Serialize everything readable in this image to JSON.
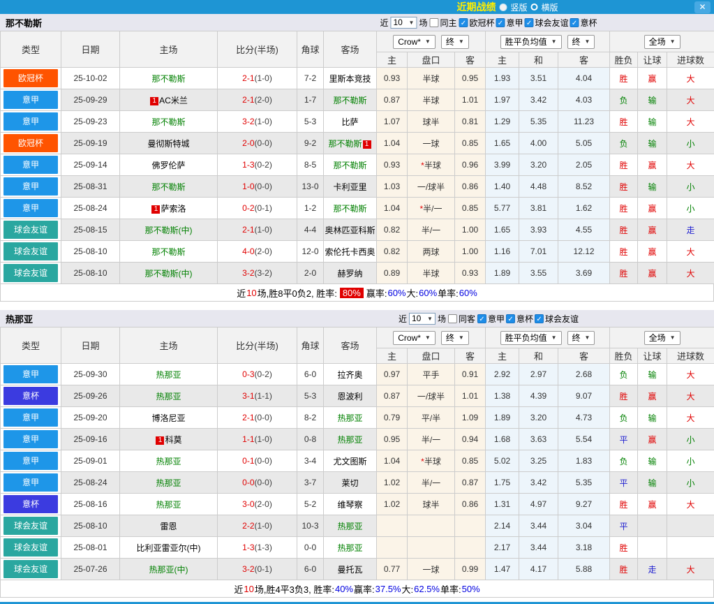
{
  "topbar": {
    "title": "近期战绩",
    "radio_vertical": "竖版",
    "radio_horizontal": "横版",
    "close": "✕"
  },
  "table_header": {
    "main_cols": [
      "类型",
      "日期",
      "主场",
      "比分(半场)",
      "角球",
      "客场"
    ],
    "sub_cols": [
      "主",
      "盘口",
      "客",
      "主",
      "和",
      "客",
      "胜负",
      "让球",
      "进球数"
    ],
    "odds_select": "Crow*",
    "odds_final_select": "终",
    "mean_select": "胜平负均值",
    "mean_final_select": "终",
    "scope_select": "全场",
    "caret": "▼"
  },
  "type_colors": {
    "欧冠杯": "#ff5400",
    "意甲": "#1e96e8",
    "意杯": "#3b3be0",
    "球会友谊": "#2aa7a0"
  },
  "sections": [
    {
      "team": "那不勒斯",
      "filter": {
        "near": "近",
        "count": "10",
        "games": "场",
        "same_label": "同主",
        "same_checked": false,
        "check_glyph": "✓",
        "leagues": [
          {
            "label": "欧冠杯",
            "checked": true
          },
          {
            "label": "意甲",
            "checked": true
          },
          {
            "label": "球会友谊",
            "checked": true
          },
          {
            "label": "意杯",
            "checked": true
          }
        ]
      },
      "rows": [
        {
          "type": "欧冠杯",
          "date": "25-10-02",
          "home": {
            "name": "那不勒斯",
            "green": true
          },
          "ft": "2-1",
          "ht": "(1-0)",
          "corner": "7-2",
          "away": {
            "name": "里斯本竞技"
          },
          "odds": [
            "0.93",
            "半球",
            "0.95"
          ],
          "mean": [
            "1.93",
            "3.51",
            "4.04"
          ],
          "res": [
            [
              "胜",
              "r"
            ],
            [
              "赢",
              "r"
            ],
            [
              "大",
              "r"
            ]
          ]
        },
        {
          "type": "意甲",
          "date": "25-09-29",
          "home": {
            "name": "AC米兰",
            "badge_before": "1"
          },
          "ft": "2-1",
          "ht": "(2-0)",
          "corner": "1-7",
          "away": {
            "name": "那不勒斯",
            "green": true
          },
          "odds": [
            "0.87",
            "半球",
            "1.01"
          ],
          "mean": [
            "1.97",
            "3.42",
            "4.03"
          ],
          "res": [
            [
              "负",
              "g"
            ],
            [
              "输",
              "g"
            ],
            [
              "大",
              "r"
            ]
          ]
        },
        {
          "type": "意甲",
          "date": "25-09-23",
          "home": {
            "name": "那不勒斯",
            "green": true
          },
          "ft": "3-2",
          "ht": "(1-0)",
          "corner": "5-3",
          "away": {
            "name": "比萨"
          },
          "odds": [
            "1.07",
            "球半",
            "0.81"
          ],
          "mean": [
            "1.29",
            "5.35",
            "11.23"
          ],
          "res": [
            [
              "胜",
              "r"
            ],
            [
              "输",
              "g"
            ],
            [
              "大",
              "r"
            ]
          ]
        },
        {
          "type": "欧冠杯",
          "date": "25-09-19",
          "home": {
            "name": "曼彻斯特城"
          },
          "ft": "2-0",
          "ht": "(0-0)",
          "corner": "9-2",
          "away": {
            "name": "那不勒斯",
            "green": true,
            "badge_after": "1"
          },
          "odds": [
            "1.04",
            "一球",
            "0.85"
          ],
          "mean": [
            "1.65",
            "4.00",
            "5.05"
          ],
          "res": [
            [
              "负",
              "g"
            ],
            [
              "输",
              "g"
            ],
            [
              "小",
              "g"
            ]
          ]
        },
        {
          "type": "意甲",
          "date": "25-09-14",
          "home": {
            "name": "佛罗伦萨"
          },
          "ft": "1-3",
          "ht": "(0-2)",
          "corner": "8-5",
          "away": {
            "name": "那不勒斯",
            "green": true
          },
          "odds": [
            "0.93",
            "*半球",
            "0.96"
          ],
          "mean": [
            "3.99",
            "3.20",
            "2.05"
          ],
          "res": [
            [
              "胜",
              "r"
            ],
            [
              "赢",
              "r"
            ],
            [
              "大",
              "r"
            ]
          ]
        },
        {
          "type": "意甲",
          "date": "25-08-31",
          "home": {
            "name": "那不勒斯",
            "green": true
          },
          "ft": "1-0",
          "ht": "(0-0)",
          "corner": "13-0",
          "away": {
            "name": "卡利亚里"
          },
          "odds": [
            "1.03",
            "一/球半",
            "0.86"
          ],
          "mean": [
            "1.40",
            "4.48",
            "8.52"
          ],
          "res": [
            [
              "胜",
              "r"
            ],
            [
              "输",
              "g"
            ],
            [
              "小",
              "g"
            ]
          ]
        },
        {
          "type": "意甲",
          "date": "25-08-24",
          "home": {
            "name": "萨索洛",
            "badge_before": "1"
          },
          "ft": "0-2",
          "ht": "(0-1)",
          "corner": "1-2",
          "away": {
            "name": "那不勒斯",
            "green": true
          },
          "odds": [
            "1.04",
            "*半/一",
            "0.85"
          ],
          "mean": [
            "5.77",
            "3.81",
            "1.62"
          ],
          "res": [
            [
              "胜",
              "r"
            ],
            [
              "赢",
              "r"
            ],
            [
              "小",
              "g"
            ]
          ]
        },
        {
          "type": "球会友谊",
          "date": "25-08-15",
          "home": {
            "name": "那不勒斯(中)",
            "green": true
          },
          "ft": "2-1",
          "ht": "(1-0)",
          "corner": "4-4",
          "away": {
            "name": "奥林匹亚科斯"
          },
          "odds": [
            "0.82",
            "半/一",
            "1.00"
          ],
          "mean": [
            "1.65",
            "3.93",
            "4.55"
          ],
          "res": [
            [
              "胜",
              "r"
            ],
            [
              "赢",
              "r"
            ],
            [
              "走",
              "b"
            ]
          ]
        },
        {
          "type": "球会友谊",
          "date": "25-08-10",
          "home": {
            "name": "那不勒斯",
            "green": true
          },
          "ft": "4-0",
          "ht": "(2-0)",
          "corner": "12-0",
          "away": {
            "name": "索伦托卡西奥"
          },
          "odds": [
            "0.82",
            "两球",
            "1.00"
          ],
          "mean": [
            "1.16",
            "7.01",
            "12.12"
          ],
          "res": [
            [
              "胜",
              "r"
            ],
            [
              "赢",
              "r"
            ],
            [
              "大",
              "r"
            ]
          ]
        },
        {
          "type": "球会友谊",
          "date": "25-08-10",
          "home": {
            "name": "那不勒斯(中)",
            "green": true
          },
          "ft": "3-2",
          "ht": "(3-2)",
          "corner": "2-0",
          "away": {
            "name": "赫罗纳"
          },
          "odds": [
            "0.89",
            "半球",
            "0.93"
          ],
          "mean": [
            "1.89",
            "3.55",
            "3.69"
          ],
          "res": [
            [
              "胜",
              "r"
            ],
            [
              "赢",
              "r"
            ],
            [
              "大",
              "r"
            ]
          ]
        }
      ],
      "summary": [
        [
          "近",
          "k"
        ],
        [
          "10",
          "red"
        ],
        [
          "场,胜8平0负2, 胜率:",
          "k"
        ],
        [
          "80%",
          "box"
        ],
        [
          "赢率:",
          "k"
        ],
        [
          "60%",
          "blue"
        ],
        [
          " 大:",
          "k"
        ],
        [
          "60%",
          "blue"
        ],
        [
          " 单率:",
          "k"
        ],
        [
          "60%",
          "blue"
        ]
      ]
    },
    {
      "team": "热那亚",
      "filter": {
        "near": "近",
        "count": "10",
        "games": "场",
        "same_label": "同客",
        "same_checked": false,
        "check_glyph": "✓",
        "leagues": [
          {
            "label": "意甲",
            "checked": true
          },
          {
            "label": "意杯",
            "checked": true
          },
          {
            "label": "球会友谊",
            "checked": true
          }
        ]
      },
      "rows": [
        {
          "type": "意甲",
          "date": "25-09-30",
          "home": {
            "name": "热那亚",
            "green": true
          },
          "ft": "0-3",
          "ht": "(0-2)",
          "corner": "6-0",
          "away": {
            "name": "拉齐奥"
          },
          "odds": [
            "0.97",
            "平手",
            "0.91"
          ],
          "mean": [
            "2.92",
            "2.97",
            "2.68"
          ],
          "res": [
            [
              "负",
              "g"
            ],
            [
              "输",
              "g"
            ],
            [
              "大",
              "r"
            ]
          ]
        },
        {
          "type": "意杯",
          "date": "25-09-26",
          "home": {
            "name": "热那亚",
            "green": true
          },
          "ft": "3-1",
          "ht": "(1-1)",
          "corner": "5-3",
          "away": {
            "name": "恩波利"
          },
          "odds": [
            "0.87",
            "一/球半",
            "1.01"
          ],
          "mean": [
            "1.38",
            "4.39",
            "9.07"
          ],
          "res": [
            [
              "胜",
              "r"
            ],
            [
              "赢",
              "r"
            ],
            [
              "大",
              "r"
            ]
          ]
        },
        {
          "type": "意甲",
          "date": "25-09-20",
          "home": {
            "name": "博洛尼亚"
          },
          "ft": "2-1",
          "ht": "(0-0)",
          "corner": "8-2",
          "away": {
            "name": "热那亚",
            "green": true
          },
          "odds": [
            "0.79",
            "平/半",
            "1.09"
          ],
          "mean": [
            "1.89",
            "3.20",
            "4.73"
          ],
          "res": [
            [
              "负",
              "g"
            ],
            [
              "输",
              "g"
            ],
            [
              "大",
              "r"
            ]
          ]
        },
        {
          "type": "意甲",
          "date": "25-09-16",
          "home": {
            "name": "科莫",
            "badge_before": "1"
          },
          "ft": "1-1",
          "ht": "(1-0)",
          "corner": "0-8",
          "away": {
            "name": "热那亚",
            "green": true
          },
          "odds": [
            "0.95",
            "半/一",
            "0.94"
          ],
          "mean": [
            "1.68",
            "3.63",
            "5.54"
          ],
          "res": [
            [
              "平",
              "b"
            ],
            [
              "赢",
              "r"
            ],
            [
              "小",
              "g"
            ]
          ]
        },
        {
          "type": "意甲",
          "date": "25-09-01",
          "home": {
            "name": "热那亚",
            "green": true
          },
          "ft": "0-1",
          "ht": "(0-0)",
          "corner": "3-4",
          "away": {
            "name": "尤文图斯"
          },
          "odds": [
            "1.04",
            "*半球",
            "0.85"
          ],
          "mean": [
            "5.02",
            "3.25",
            "1.83"
          ],
          "res": [
            [
              "负",
              "g"
            ],
            [
              "输",
              "g"
            ],
            [
              "小",
              "g"
            ]
          ]
        },
        {
          "type": "意甲",
          "date": "25-08-24",
          "home": {
            "name": "热那亚",
            "green": true
          },
          "ft": "0-0",
          "ht": "(0-0)",
          "corner": "3-7",
          "away": {
            "name": "莱切"
          },
          "odds": [
            "1.02",
            "半/一",
            "0.87"
          ],
          "mean": [
            "1.75",
            "3.42",
            "5.35"
          ],
          "res": [
            [
              "平",
              "b"
            ],
            [
              "输",
              "g"
            ],
            [
              "小",
              "g"
            ]
          ]
        },
        {
          "type": "意杯",
          "date": "25-08-16",
          "home": {
            "name": "热那亚",
            "green": true
          },
          "ft": "3-0",
          "ht": "(2-0)",
          "corner": "5-2",
          "away": {
            "name": "维琴察"
          },
          "odds": [
            "1.02",
            "球半",
            "0.86"
          ],
          "mean": [
            "1.31",
            "4.97",
            "9.27"
          ],
          "res": [
            [
              "胜",
              "r"
            ],
            [
              "赢",
              "r"
            ],
            [
              "大",
              "r"
            ]
          ]
        },
        {
          "type": "球会友谊",
          "date": "25-08-10",
          "home": {
            "name": "雷恩"
          },
          "ft": "2-2",
          "ht": "(1-0)",
          "corner": "10-3",
          "away": {
            "name": "热那亚",
            "green": true
          },
          "odds": [
            "",
            "",
            ""
          ],
          "mean": [
            "2.14",
            "3.44",
            "3.04"
          ],
          "res": [
            [
              "平",
              "b"
            ],
            [
              "",
              ""
            ],
            [
              "",
              ""
            ]
          ]
        },
        {
          "type": "球会友谊",
          "date": "25-08-01",
          "home": {
            "name": "比利亚雷亚尔(中)"
          },
          "ft": "1-3",
          "ht": "(1-3)",
          "corner": "0-0",
          "away": {
            "name": "热那亚",
            "green": true
          },
          "odds": [
            "",
            "",
            ""
          ],
          "mean": [
            "2.17",
            "3.44",
            "3.18"
          ],
          "res": [
            [
              "胜",
              "r"
            ],
            [
              "",
              ""
            ],
            [
              "",
              ""
            ]
          ]
        },
        {
          "type": "球会友谊",
          "date": "25-07-26",
          "home": {
            "name": "热那亚(中)",
            "green": true
          },
          "ft": "3-2",
          "ht": "(0-1)",
          "corner": "6-0",
          "away": {
            "name": "曼托瓦"
          },
          "odds": [
            "0.77",
            "一球",
            "0.99"
          ],
          "mean": [
            "1.47",
            "4.17",
            "5.88"
          ],
          "res": [
            [
              "胜",
              "r"
            ],
            [
              "走",
              "b"
            ],
            [
              "大",
              "r"
            ]
          ]
        }
      ],
      "summary": [
        [
          "近",
          "k"
        ],
        [
          "10",
          "red"
        ],
        [
          "场,胜4平3负3, 胜率:",
          "k"
        ],
        [
          "40%",
          "blue"
        ],
        [
          " 赢率:",
          "k"
        ],
        [
          "37.5%",
          "blue"
        ],
        [
          " 大:",
          "k"
        ],
        [
          "62.5%",
          "blue"
        ],
        [
          " 单率:",
          "k"
        ],
        [
          "50%",
          "blue"
        ]
      ]
    }
  ]
}
